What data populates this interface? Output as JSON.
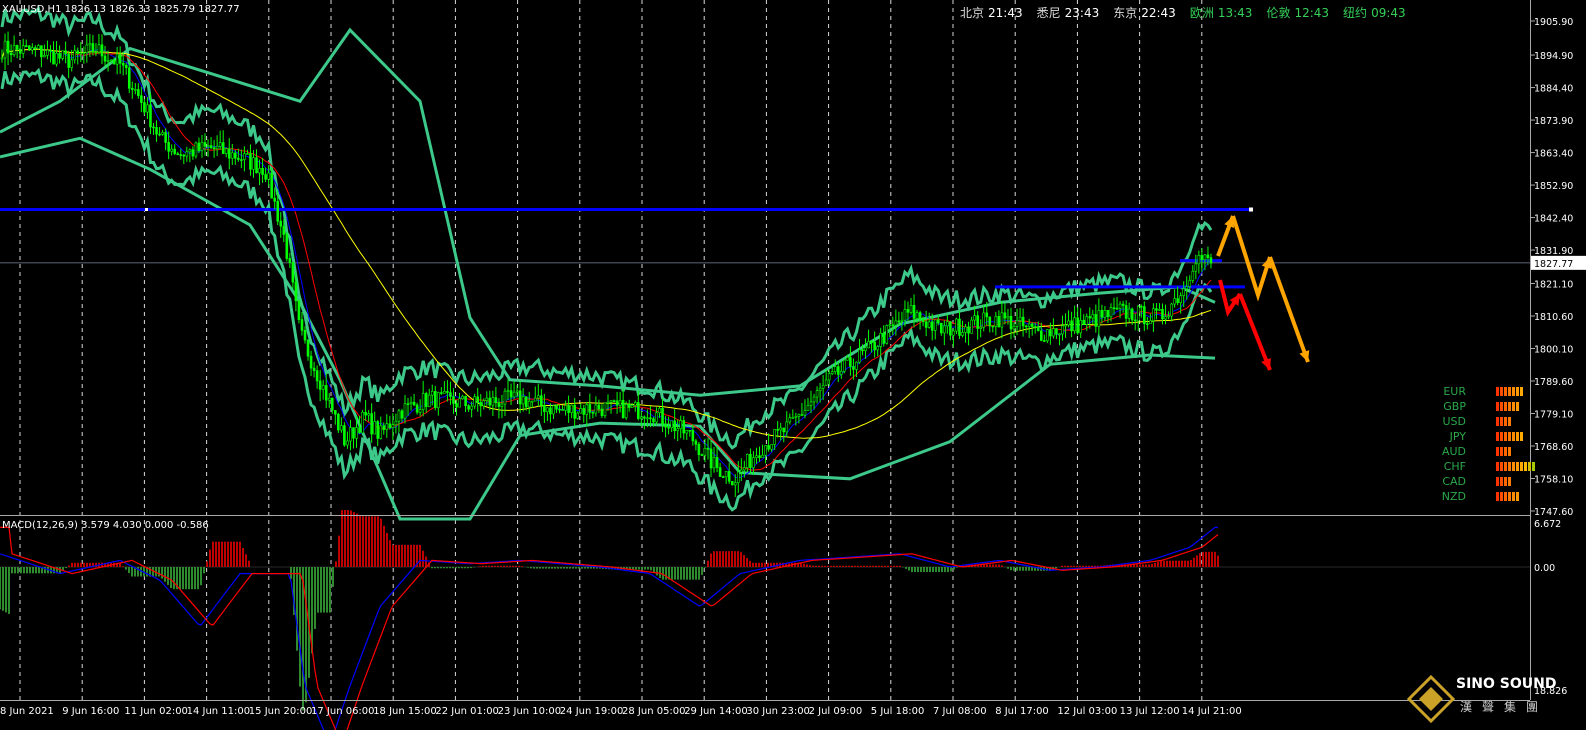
{
  "symbol_info": "XAUUSD,H1  1826.13 1826.33 1825.79 1827.77",
  "macd_info": "MACD(12,26,9) 3.579 4.030 0.000 -0.586",
  "current_price": "1827.77",
  "clocks": [
    {
      "city": "北京",
      "time": "21:43",
      "highlight": false
    },
    {
      "city": "悉尼",
      "time": "23:43",
      "highlight": false
    },
    {
      "city": "东京",
      "time": "22:43",
      "highlight": false
    },
    {
      "city": "欧洲",
      "time": "13:43",
      "highlight": true
    },
    {
      "city": "伦敦",
      "time": "12:43",
      "highlight": true
    },
    {
      "city": "纽约",
      "time": "09:43",
      "highlight": true
    }
  ],
  "price_axis": [
    {
      "label": "1905.90",
      "value": 1905.9
    },
    {
      "label": "1894.90",
      "value": 1894.9
    },
    {
      "label": "1884.40",
      "value": 1884.4
    },
    {
      "label": "1873.90",
      "value": 1873.9
    },
    {
      "label": "1863.40",
      "value": 1863.4
    },
    {
      "label": "1852.90",
      "value": 1852.9
    },
    {
      "label": "1842.40",
      "value": 1842.4
    },
    {
      "label": "1831.90",
      "value": 1831.9
    },
    {
      "label": "1821.10",
      "value": 1821.1
    },
    {
      "label": "1810.60",
      "value": 1810.6
    },
    {
      "label": "1800.10",
      "value": 1800.1
    },
    {
      "label": "1789.60",
      "value": 1789.6
    },
    {
      "label": "1779.10",
      "value": 1779.1
    },
    {
      "label": "1768.60",
      "value": 1768.6
    },
    {
      "label": "1758.10",
      "value": 1758.1
    },
    {
      "label": "1747.60",
      "value": 1747.6
    }
  ],
  "macd_axis": [
    {
      "label": "6.672",
      "value": 6.672
    },
    {
      "label": "0.00",
      "value": 0
    }
  ],
  "macd_bottom_label": "18.826",
  "time_axis": [
    "8 Jun 2021",
    "9 Jun 16:00",
    "11 Jun 02:00",
    "14 Jun 11:00",
    "15 Jun 20:00",
    "17 Jun 06:00",
    "18 Jun 15:00",
    "22 Jun 01:00",
    "23 Jun 10:00",
    "24 Jun 19:00",
    "28 Jun 05:00",
    "29 Jun 14:00",
    "30 Jun 23:00",
    "2 Jul 09:00",
    "5 Jul 18:00",
    "7 Jul 08:00",
    "8 Jul 17:00",
    "12 Jul 03:00",
    "13 Jul 12:00",
    "14 Jul 21:00"
  ],
  "strength_meter": [
    {
      "code": "EUR",
      "bars": 7
    },
    {
      "code": "GBP",
      "bars": 6
    },
    {
      "code": "USD",
      "bars": 4
    },
    {
      "code": "JPY",
      "bars": 7
    },
    {
      "code": "AUD",
      "bars": 4
    },
    {
      "code": "CHF",
      "bars": 10
    },
    {
      "code": "CAD",
      "bars": 4
    },
    {
      "code": "NZD",
      "bars": 6
    }
  ],
  "levels": [
    1845,
    1820,
    1828.5
  ],
  "logo": {
    "brand": "SINO SOUND",
    "chinese": "漢聲集團"
  },
  "colors": {
    "candles": "#00ff00",
    "bands": "#3cc98a",
    "level_line": "#0000ff",
    "ma_fast": "#0000ff",
    "ma_mid": "#ff0000",
    "ma_slow": "#ffff00",
    "forecast_up": "#ffa500",
    "forecast_down": "#ff0000",
    "macd_pos": "#c00000",
    "macd_neg": "#2e8b2e"
  }
}
